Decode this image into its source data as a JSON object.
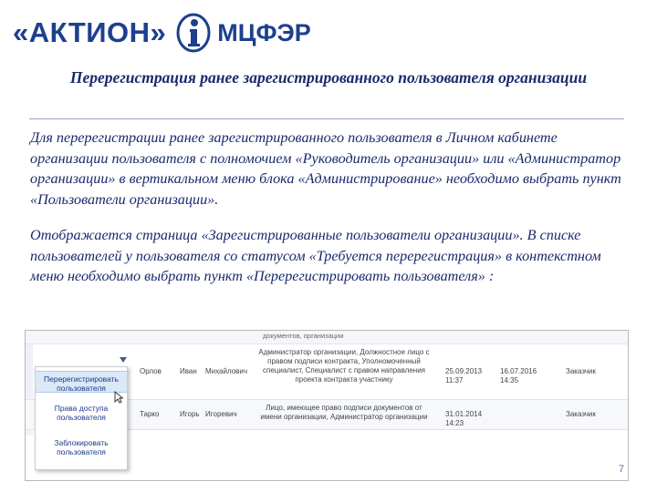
{
  "header": {
    "brand_left": "«АКТИОН»",
    "brand_right": "МЦФЭР"
  },
  "slide": {
    "title": "Перерегистрация ранее зарегистрированного пользователя организации",
    "paragraph1": "Для перерегистрации ранее зарегистрированного пользователя в Личном кабинете организации пользователя с полномочием «Руководитель организации» или «Администратор организации» в вертикальном меню блока «Администрирование» необходимо выбрать пункт «Пользователи организации».",
    "paragraph2": "Отображается страница «Зарегистрированные пользователи организации». В списке пользователей у пользователя со статусом «Требуется перерегистрация» в контекстном меню необходимо выбрать пункт «Перерегистрировать пользователя» :",
    "page_number": "7"
  },
  "screenshot": {
    "top_text": "документов, организации",
    "rows": [
      {
        "last_name": "Орлов",
        "first_name": "Иван",
        "patronymic": "Михайлович",
        "roles": "Администратор организации, Должностное лицо с правом подписи контракта, Уполномоченный специалист, Специалист с правом направления проекта контракта участнику",
        "date_from": "25.09.2013 11:37",
        "date_to": "16.07.2016 14:35",
        "type": "Заказчик"
      },
      {
        "last_name": "Тарко",
        "first_name": "Игорь",
        "patronymic": "Игоревич",
        "roles": "Лицо, имеющее право подписи документов от имени организации, Администратор организации",
        "date_from": "31.01.2014 14:23",
        "date_to": "",
        "type": "Заказчик"
      }
    ],
    "context_menu": {
      "items": [
        "Перерегистрировать пользователя",
        "Права доступа пользователя",
        "Заблокировать пользователя"
      ]
    }
  },
  "colors": {
    "text": "#1a2a6c",
    "brand": "#1d3f8f",
    "menu_highlight": "#dbe8f7"
  }
}
